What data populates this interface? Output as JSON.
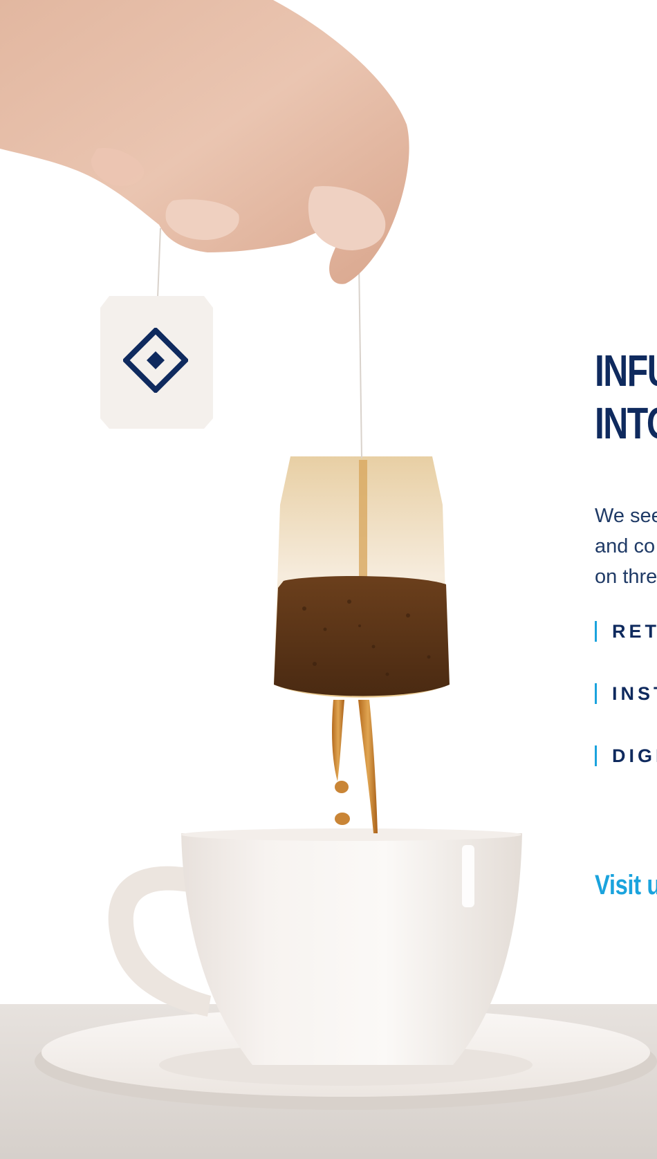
{
  "hero": {
    "headline_lines": [
      "INFU",
      "INTO"
    ],
    "body_lines": [
      "We see",
      "and co",
      "on thre"
    ]
  },
  "services": [
    {
      "label": "RETA"
    },
    {
      "label": "INST"
    },
    {
      "label": "DIGIT"
    }
  ],
  "visit_link_label": "Visit u",
  "colors": {
    "navy": "#0f2a5e",
    "accent": "#1aa3dd",
    "background": "#ffffff"
  },
  "icons": {
    "tea_tag_logo": "diamond-icon"
  }
}
